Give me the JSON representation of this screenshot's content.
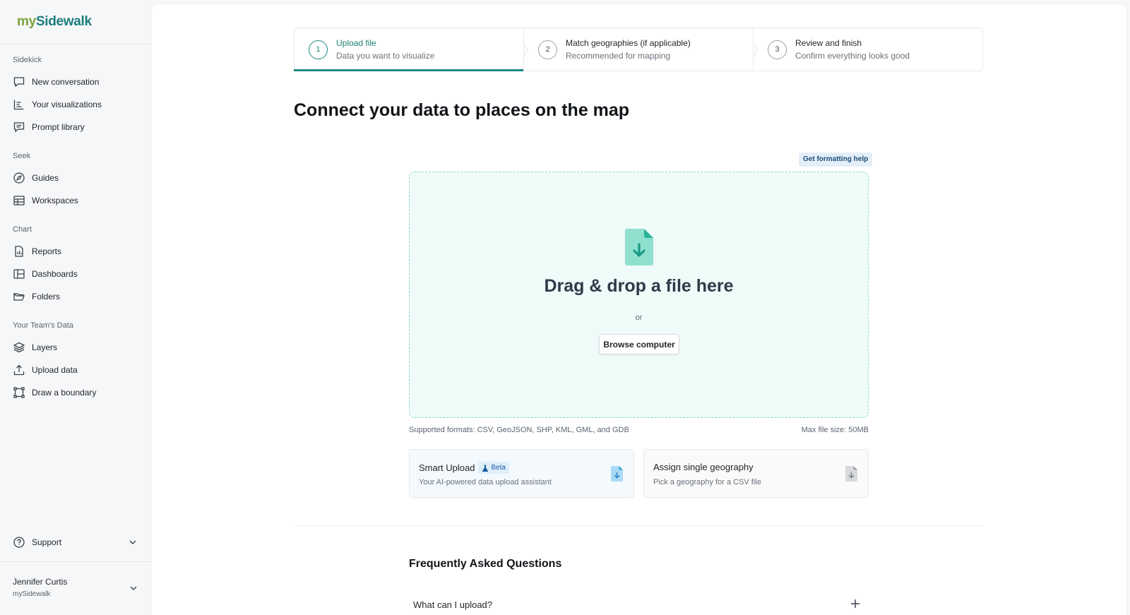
{
  "brand": {
    "logo_prefix": "my",
    "logo_main": "Sidewalk",
    "accent": "#1d8a7e"
  },
  "sidebar": {
    "sections": [
      {
        "label": "Sidekick",
        "items": [
          {
            "label": "New conversation",
            "icon": "chat-icon"
          },
          {
            "label": "Your visualizations",
            "icon": "bar-list-icon"
          },
          {
            "label": "Prompt library",
            "icon": "message-lines-icon"
          }
        ]
      },
      {
        "label": "Seek",
        "items": [
          {
            "label": "Guides",
            "icon": "compass-icon"
          },
          {
            "label": "Workspaces",
            "icon": "table-grid-icon"
          }
        ]
      },
      {
        "label": "Chart",
        "items": [
          {
            "label": "Reports",
            "icon": "report-icon"
          },
          {
            "label": "Dashboards",
            "icon": "dashboard-icon"
          },
          {
            "label": "Folders",
            "icon": "folder-open-icon"
          }
        ]
      },
      {
        "label": "Your Team's Data",
        "items": [
          {
            "label": "Layers",
            "icon": "layers-icon"
          },
          {
            "label": "Upload data",
            "icon": "upload-icon"
          },
          {
            "label": "Draw a boundary",
            "icon": "boundary-icon"
          }
        ]
      }
    ],
    "support_label": "Support",
    "user": {
      "name": "Jennifer Curtis",
      "org": "mySidewalk"
    }
  },
  "stepper": [
    {
      "num": "1",
      "title": "Upload file",
      "sub": "Data you want to visualize",
      "active": true
    },
    {
      "num": "2",
      "title": "Match geographies (if applicable)",
      "sub": "Recommended for mapping",
      "active": false
    },
    {
      "num": "3",
      "title": "Review and finish",
      "sub": "Confirm everything looks good",
      "active": false
    }
  ],
  "main": {
    "title": "Connect your data to places on the map",
    "help_badge": "Get formatting help",
    "dropzone": {
      "title": "Drag & drop a file here",
      "or": "or",
      "browse": "Browse computer"
    },
    "formats": "Supported formats: CSV, GeoJSON, SHP, KML, GML, and GDB",
    "max_size": "Max file size: 50MB",
    "cards": [
      {
        "title": "Smart Upload",
        "badge": "Beta",
        "sub": "Your AI-powered data upload assistant"
      },
      {
        "title": "Assign single geography",
        "sub": "Pick a geography for a CSV file"
      }
    ],
    "faq_title": "Frequently Asked Questions",
    "faq": [
      {
        "q": "What can I upload?"
      }
    ]
  }
}
